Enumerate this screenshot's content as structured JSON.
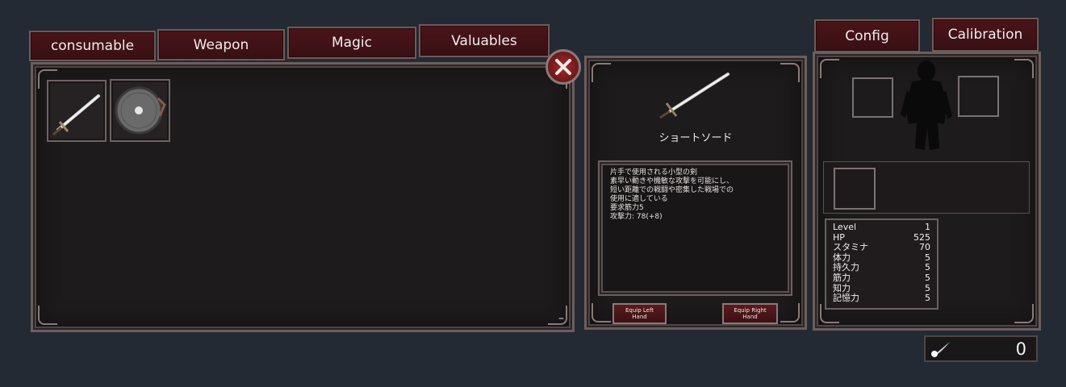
{
  "tabs": [
    "consumable",
    "Weapon",
    "Magic",
    "Valuables"
  ],
  "top_buttons": {
    "config": "Config",
    "calibration": "Calibration"
  },
  "inventory": {
    "items": [
      {
        "icon": "sword-icon"
      },
      {
        "icon": "round-shield-icon"
      }
    ],
    "scroll_mark": "–"
  },
  "item_detail": {
    "name": "ショートソード",
    "description": [
      "片手で使用される小型の剣",
      "素早い動きや機敏な攻撃を可能にし、",
      "短い距離での戦闘や密集した戦場での",
      "使用に適している",
      "",
      "要求筋力5",
      "攻撃力: 78(+8)"
    ],
    "equip_left": [
      "Equip Left",
      "Hand"
    ],
    "equip_right": [
      "Equip Right",
      "Hand"
    ]
  },
  "stats": [
    {
      "label": "Level",
      "value": "1"
    },
    {
      "label": "HP",
      "value": "525"
    },
    {
      "label": "スタミナ",
      "value": "70"
    },
    {
      "label": "体力",
      "value": "5"
    },
    {
      "label": "持久力",
      "value": "5"
    },
    {
      "label": "筋力",
      "value": "5"
    },
    {
      "label": "知力",
      "value": "5"
    },
    {
      "label": "記憶力",
      "value": "5"
    }
  ],
  "currency": {
    "icon": "soul-orb-icon",
    "value": "0"
  },
  "colors": {
    "tab_bg": "#4a1418",
    "frame": "#6b5e5e",
    "background": "#232a33"
  }
}
